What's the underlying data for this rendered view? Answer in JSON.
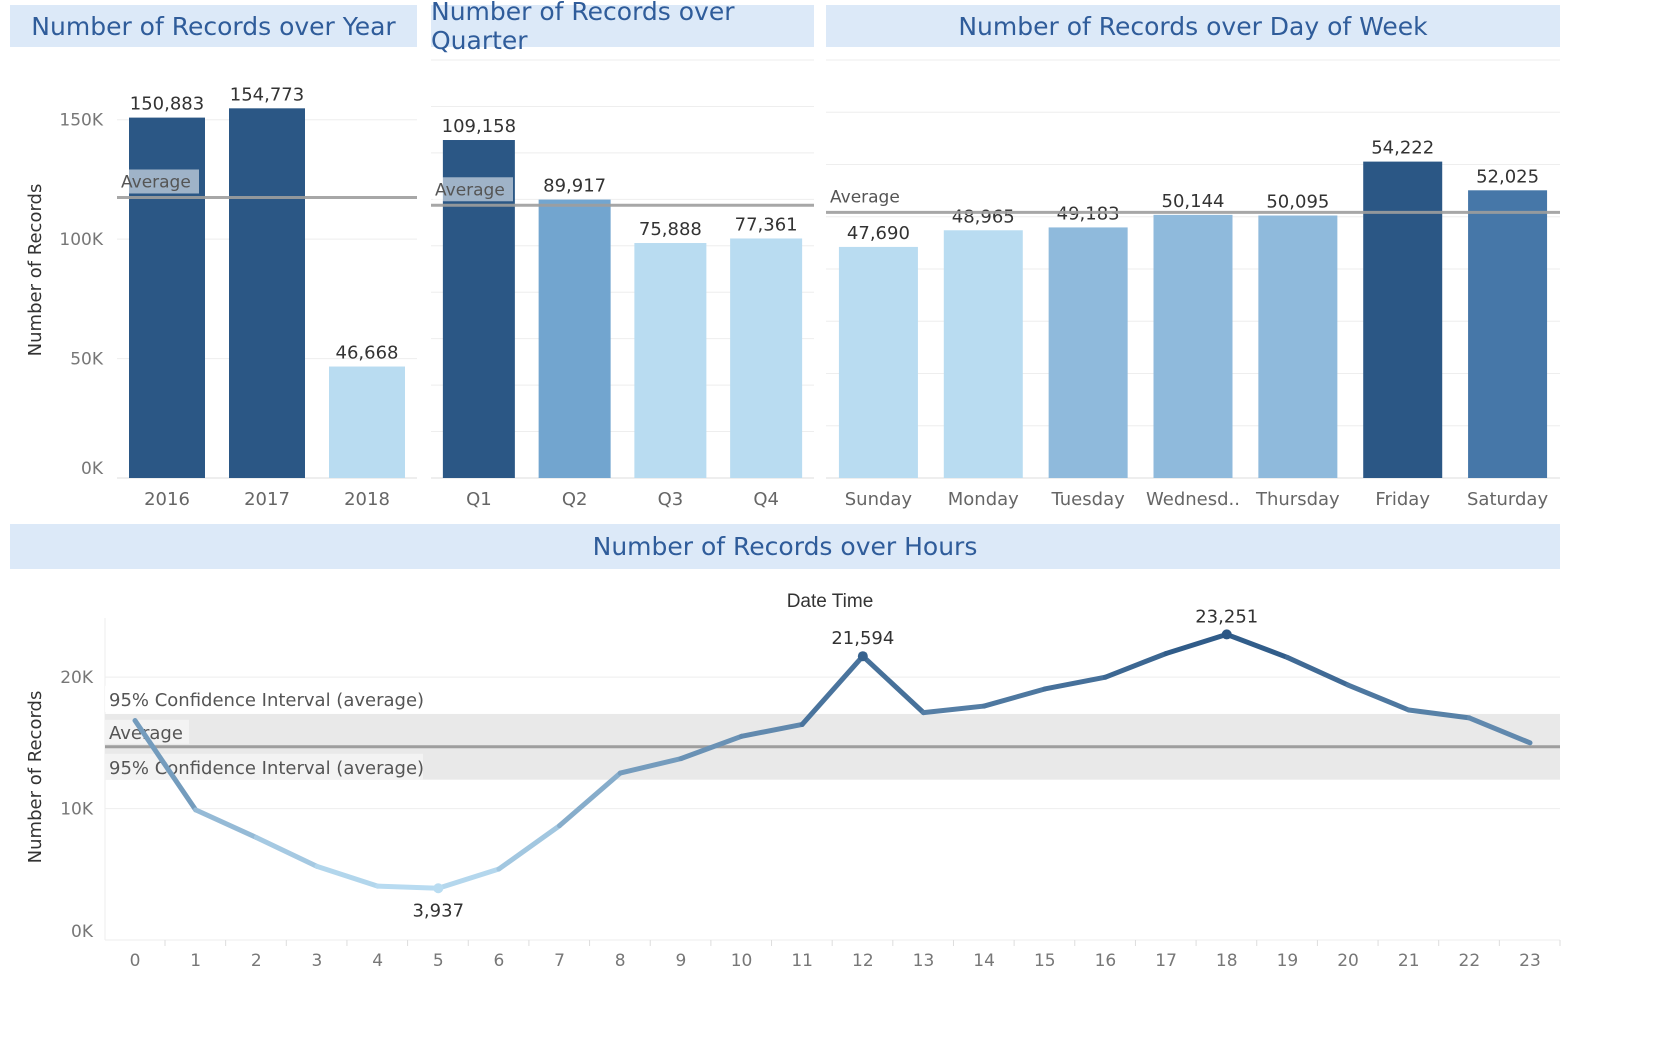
{
  "colors": {
    "title_band": "#dce9f8",
    "title_text": "#2f5c9a",
    "dark": "#2b5785",
    "mid_dark": "#4677a8",
    "mid": "#72a5cf",
    "light_mid": "#8fbadc",
    "light": "#b9dcf1",
    "average_line": "#9e9e9e",
    "ci_band": "#e9e9e9"
  },
  "chart_data": [
    {
      "type": "bar",
      "title": "Number of Records over Year",
      "ylabel": "Number of Records",
      "yticks": [
        "0K",
        "50K",
        "100K",
        "150K"
      ],
      "ylim": [
        0,
        175000
      ],
      "categories": [
        "2016",
        "2017",
        "2018"
      ],
      "values": [
        150883,
        154773,
        46668
      ],
      "value_labels": [
        "150,883",
        "154,773",
        "46,668"
      ],
      "average": 117441,
      "average_label": "Average",
      "bar_colors": [
        "dark",
        "dark",
        "light"
      ]
    },
    {
      "type": "bar",
      "title": "Number of Records over Quarter",
      "ylim": [
        0,
        135000
      ],
      "categories": [
        "Q1",
        "Q2",
        "Q3",
        "Q4"
      ],
      "values": [
        109158,
        89917,
        75888,
        77361
      ],
      "value_labels": [
        "109,158",
        "89,917",
        "75,888",
        "77,361"
      ],
      "average": 88081,
      "average_label": "Average",
      "bar_colors": [
        "dark",
        "mid",
        "light",
        "light"
      ]
    },
    {
      "type": "bar",
      "title": "Number of Records over Day of Week",
      "ylim": [
        30000,
        62000
      ],
      "categories": [
        "Sunday",
        "Monday",
        "Tuesday",
        "Wednesd..",
        "Thursday",
        "Friday",
        "Saturday"
      ],
      "values": [
        47690,
        48965,
        49183,
        50144,
        50095,
        54222,
        52025
      ],
      "value_labels": [
        "47,690",
        "48,965",
        "49,183",
        "50,144",
        "50,095",
        "54,222",
        "52,025"
      ],
      "average": 50332,
      "average_label": "Average",
      "bar_colors": [
        "light",
        "light",
        "light_mid",
        "light_mid",
        "light_mid",
        "dark",
        "mid_dark"
      ]
    },
    {
      "type": "line",
      "title": "Number of Records over Hours",
      "header": "Date Time",
      "ylabel": "Number of Records",
      "yticks": [
        "0K",
        "10K",
        "20K"
      ],
      "ylim": [
        0,
        24500
      ],
      "x": [
        "0",
        "1",
        "2",
        "3",
        "4",
        "5",
        "6",
        "7",
        "8",
        "9",
        "10",
        "11",
        "12",
        "13",
        "14",
        "15",
        "16",
        "17",
        "18",
        "19",
        "20",
        "21",
        "22",
        "23"
      ],
      "values": [
        16700,
        9900,
        7800,
        5600,
        4100,
        3937,
        5400,
        8700,
        12700,
        13800,
        15500,
        16400,
        21594,
        17300,
        17800,
        19100,
        20000,
        21800,
        23251,
        21500,
        19400,
        17500,
        16900,
        15000
      ],
      "average": 14700,
      "ci": [
        12200,
        17200
      ],
      "average_label": "Average",
      "ci_label": "95% Confidence Interval (average)",
      "point_labels": [
        {
          "index": 5,
          "text": "3,937"
        },
        {
          "index": 12,
          "text": "21,594"
        },
        {
          "index": 18,
          "text": "23,251"
        }
      ]
    }
  ]
}
